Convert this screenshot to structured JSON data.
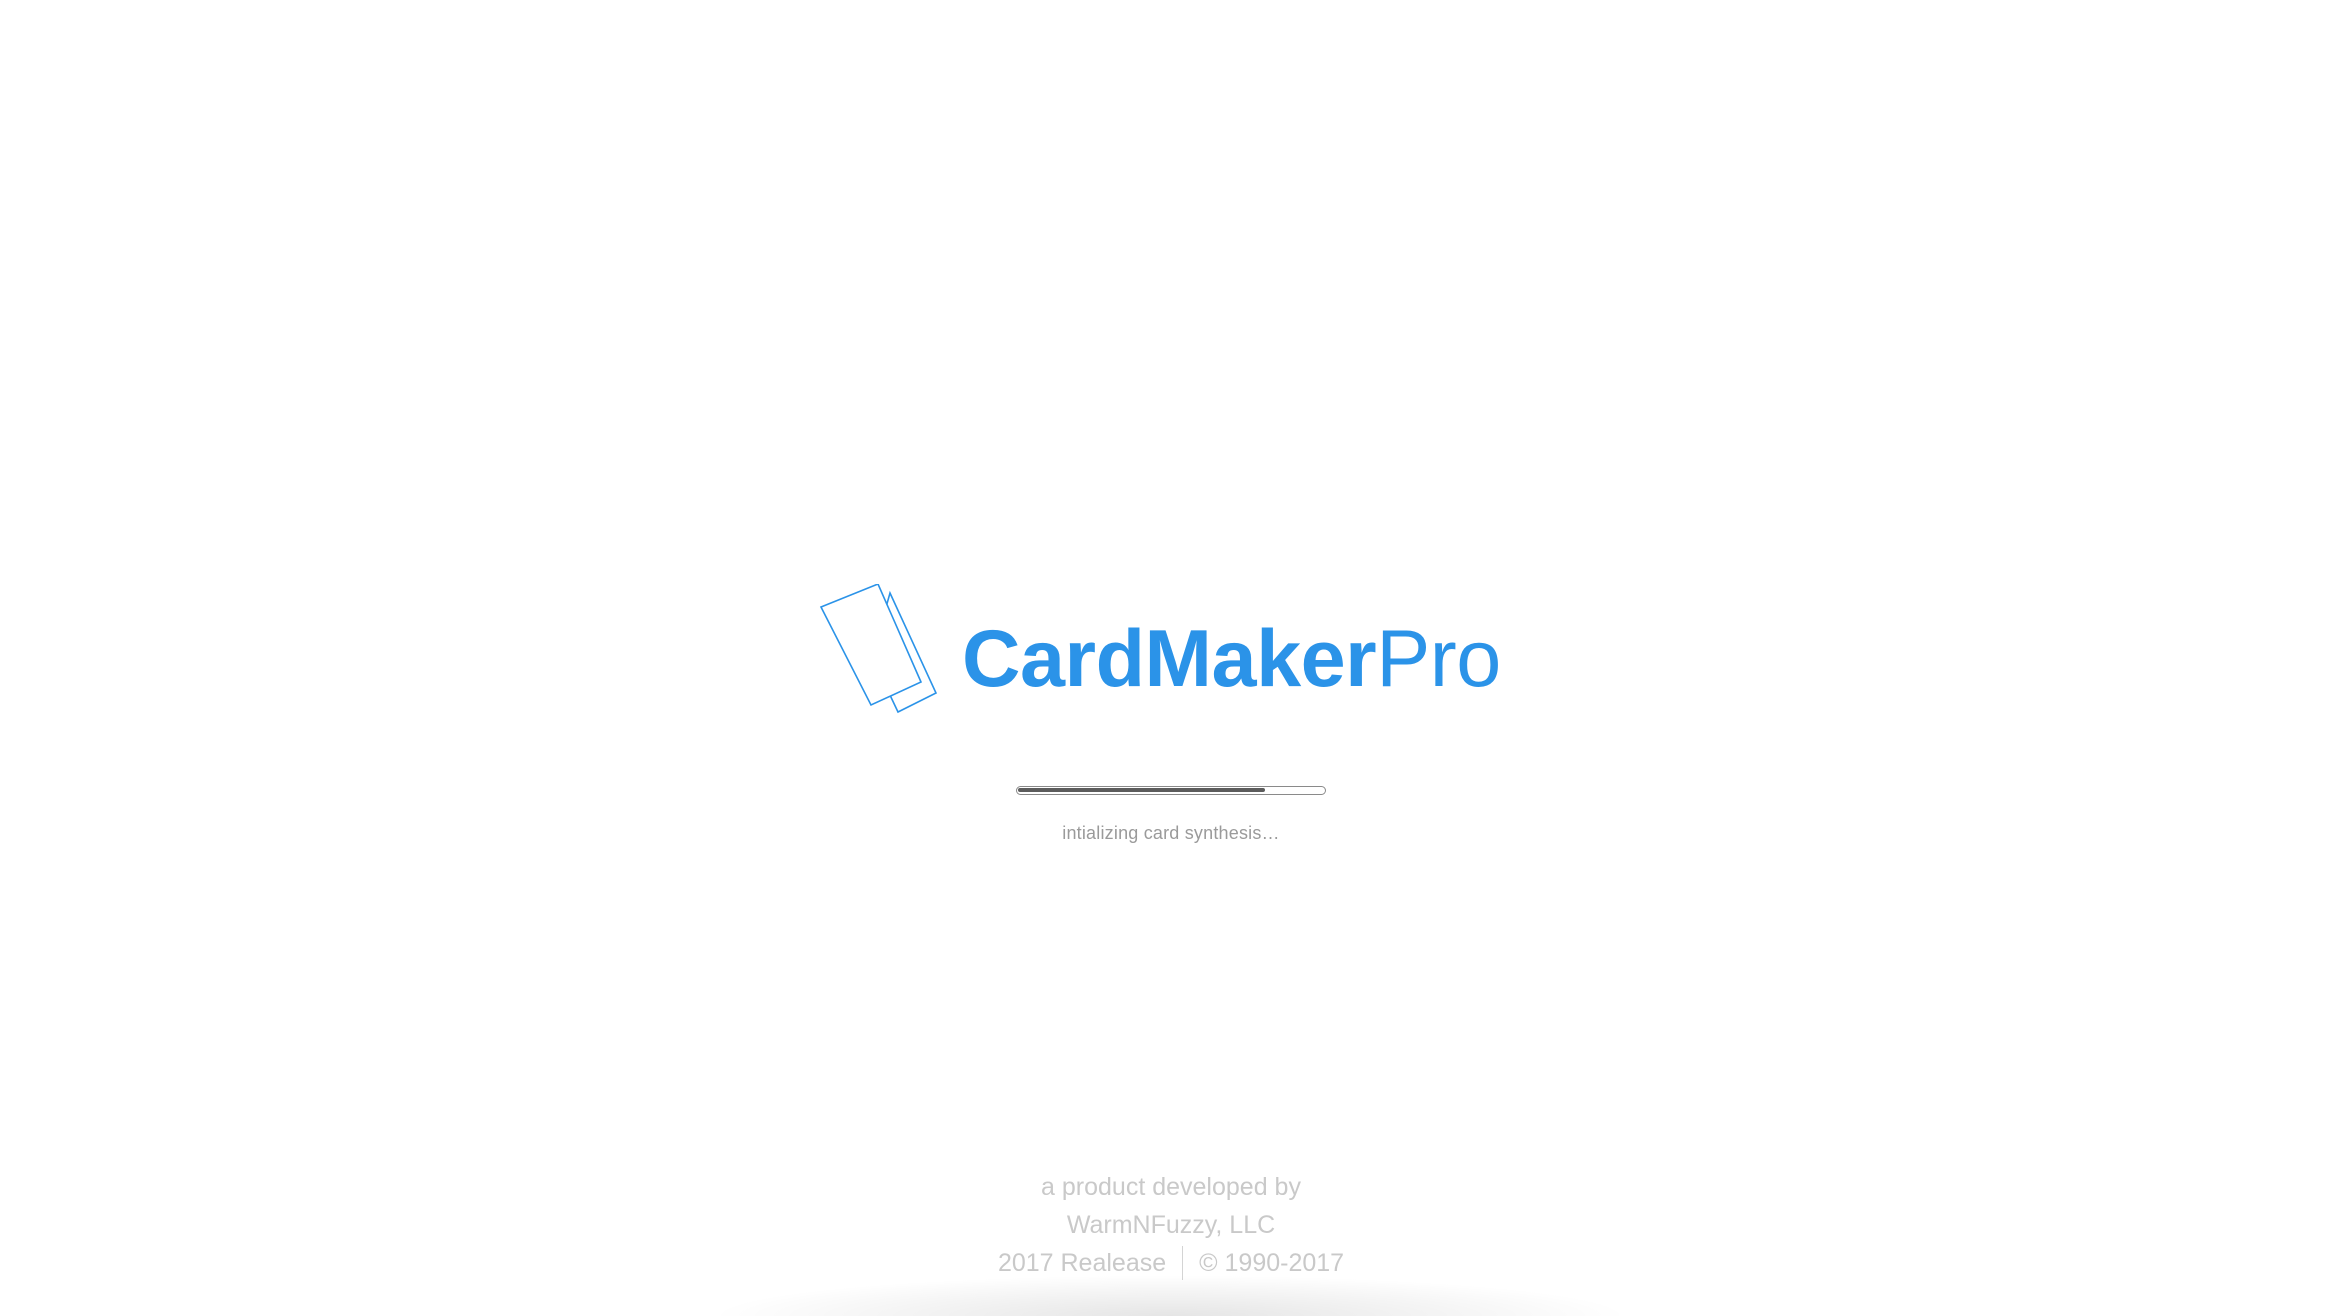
{
  "colors": {
    "accent": "#2b93e8",
    "progress_fill": "#5c5c5c",
    "footer_text": "#c9c9c9",
    "status_text": "#9a9a9a"
  },
  "logo": {
    "icon": "stacked-cards-icon",
    "name_strong": "CardMaker",
    "name_light": "Pro"
  },
  "progress": {
    "value": 0.81,
    "status": "intializing card synthesis…"
  },
  "footer": {
    "line1": "a product developed by",
    "line2": "WarmNFuzzy, LLC",
    "release": "2017 Realease",
    "copyright": "© 1990-2017"
  }
}
